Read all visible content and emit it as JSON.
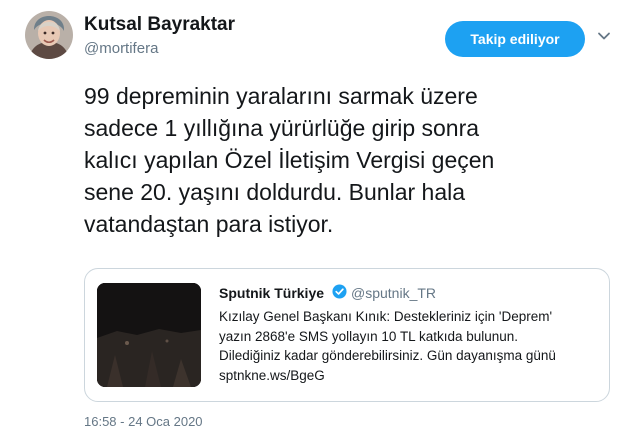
{
  "author": {
    "display_name": "Kutsal Bayraktar",
    "handle": "@mortifera",
    "avatar_icon": "profile-photo"
  },
  "follow_button": {
    "label": "Takip ediliyor"
  },
  "more_menu": {
    "icon": "chevron-down-icon"
  },
  "tweet": {
    "lines": [
      "99 depreminin yaralarını sarmak üzere",
      "sadece 1 yıllığına yürürlüğe girip sonra",
      "kalıcı yapılan Özel İletişim Vergisi geçen",
      "sene 20. yaşını doldurdu. Bunlar hala",
      "vatandaştan para istiyor."
    ]
  },
  "quoted_tweet": {
    "display_name": "Sputnik Türkiye",
    "handle": "@sputnik_TR",
    "verified_icon": "verified-badge-icon",
    "lines": [
      "Kızılay Genel Başkanı Kınık: Destekleriniz için 'Deprem'",
      "yazın 2868'e SMS yollayın 10 TL katkıda bulunun.",
      "Dilediğiniz kadar gönderebilirsiniz. Gün dayanışma günü",
      "sptnkne.ws/BgeG"
    ]
  },
  "timestamp": "16:58 - 24 Oca 2020",
  "colors": {
    "accent": "#1da1f2",
    "text": "#14171a",
    "muted": "#657786",
    "border": "#ccd6dd"
  }
}
